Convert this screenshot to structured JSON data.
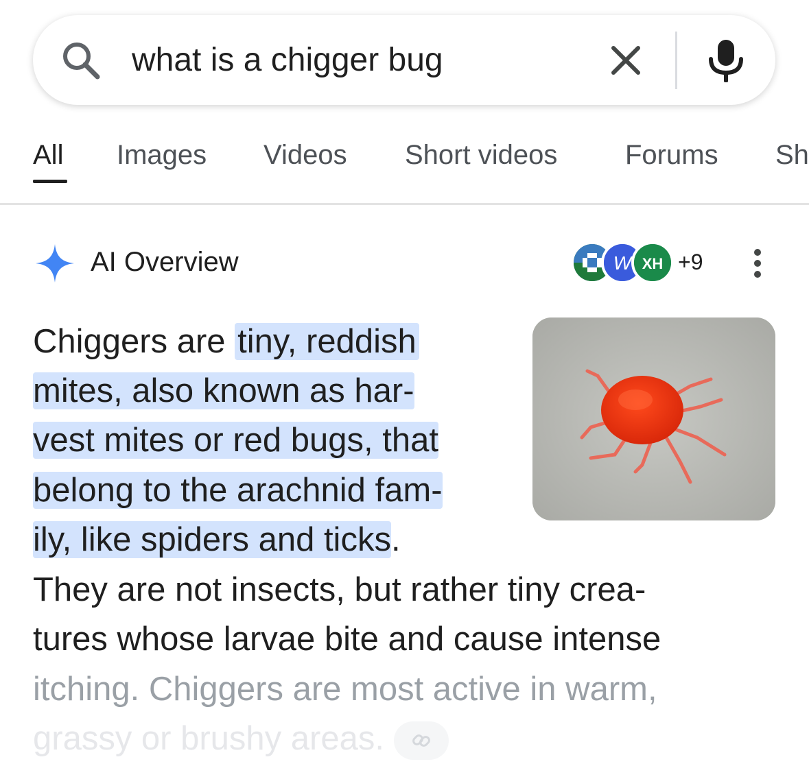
{
  "search": {
    "query": "what is a chigger bug"
  },
  "tabs": [
    {
      "label": "All",
      "active": true
    },
    {
      "label": "Images"
    },
    {
      "label": "Videos"
    },
    {
      "label": "Short videos"
    },
    {
      "label": "Forums"
    },
    {
      "label": "Sh"
    }
  ],
  "ai_overview": {
    "title": "AI Overview",
    "sources": {
      "avatars": [
        {
          "name": "cleveland-clinic",
          "color": "#1f7a3a"
        },
        {
          "name": "webmd",
          "letter": "W",
          "color": "#3a5bdc"
        },
        {
          "name": "healthline",
          "letter": "XH",
          "color": "#1a8a4a"
        }
      ],
      "more_count": "+9"
    },
    "text": {
      "l1_plain": "Chiggers are ",
      "l1_hl": "tiny, reddish",
      "l2_hl": "mites, also known as har-",
      "l3_hl": "vest mites or red bugs, that",
      "l4_hl": "belong to the arachnid fam-",
      "l5_hl": "ily, like spiders and ticks",
      "l5_plain": ".",
      "l6": "They are not insects, but rather tiny crea-",
      "l7": "tures whose larvae bite and cause intense",
      "l8": "itching. Chiggers are most active in warm,",
      "l9": "grassy or brushy areas."
    },
    "image": {
      "subject": "red chigger mite on gray surface"
    }
  },
  "colors": {
    "highlight": "#d3e3fd",
    "accent_blue": "#4285f4"
  }
}
